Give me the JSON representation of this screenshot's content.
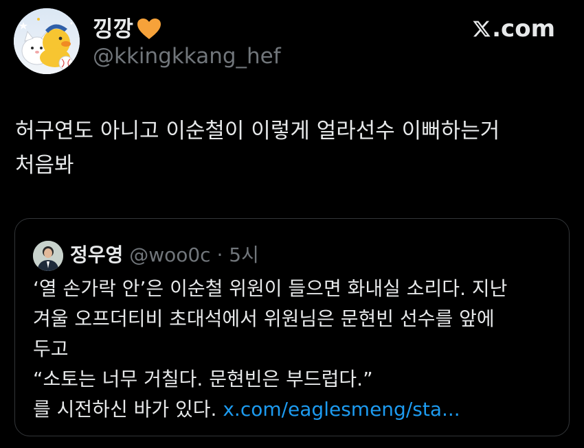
{
  "author": {
    "display_name": "낑깡",
    "emoji": "orange-heart-icon",
    "handle": "@kkingkkang_hef"
  },
  "source": {
    "logo_text": ".com",
    "logo_icon": "x-logo-icon"
  },
  "tweet": {
    "text": "허구연도 아니고 이순철이 이렇게 얼라선수 이뻐하는거\n처음봐"
  },
  "quote": {
    "display_name": "정우영",
    "handle": "@woo0c",
    "separator": "·",
    "time": "5시",
    "lines": [
      "‘열 손가락 안’은 이순철 위원이 들으면 화내실 소리다. 지난",
      "겨울 오프더티비 초대석에서 위원님은 문현빈 선수를 앞에",
      "두고",
      "“소토는 너무 거칠다. 문현빈은 부드럽다.”"
    ],
    "last_line_text": "를 시전하신 바가 있다. ",
    "link_text": "x.com/eaglesmeng/sta..."
  },
  "colors": {
    "background": "#000000",
    "text_primary": "#e7e9ea",
    "text_secondary": "#71767b",
    "link": "#1d9bf0",
    "heart": "#f6a23a",
    "border": "#333639"
  }
}
